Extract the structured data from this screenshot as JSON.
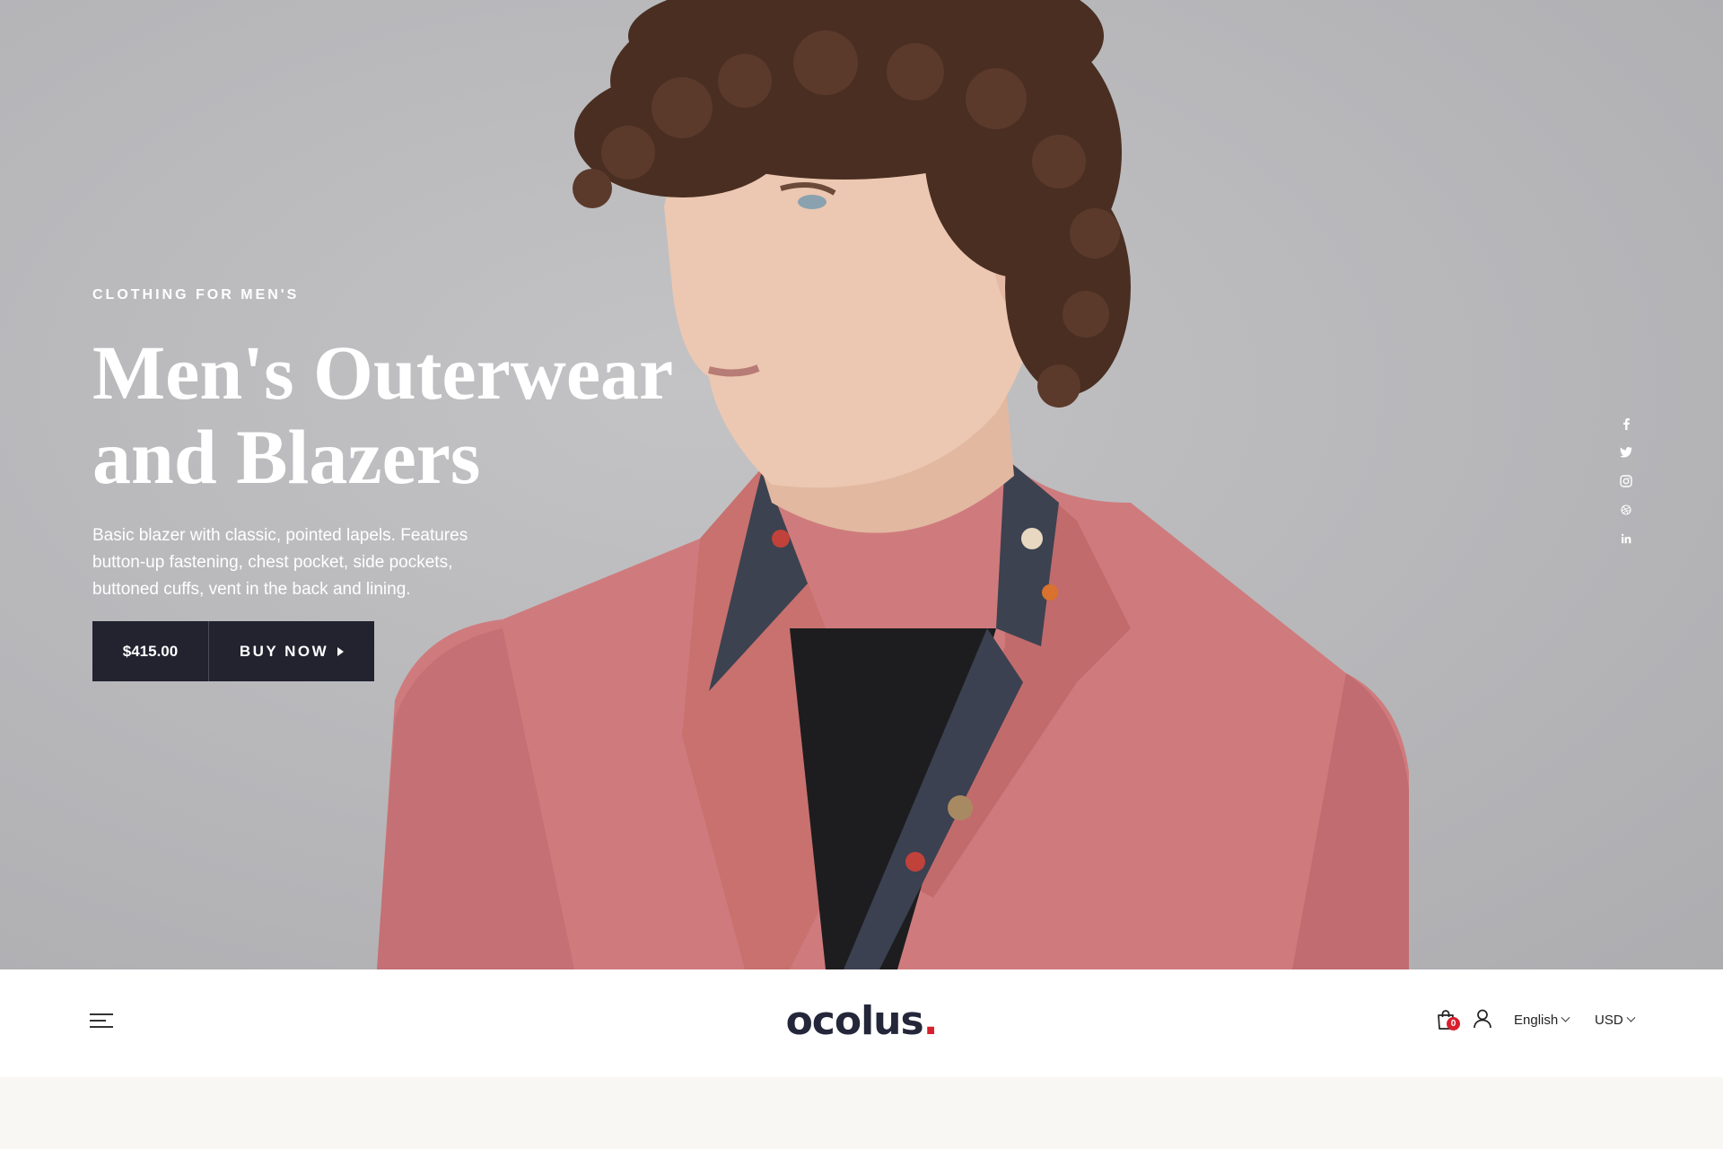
{
  "hero": {
    "eyebrow": "CLOTHING FOR MEN'S",
    "headline_line1": "Men's Outerwear",
    "headline_line2": "and Blazers",
    "description": "Basic blazer with classic, pointed lapels. Features button-up fastening, chest pocket, side pockets, buttoned cuffs, vent in the back and lining.",
    "price": "$415.00",
    "buy_label": "BUY NOW"
  },
  "social": [
    "facebook-icon",
    "twitter-icon",
    "instagram-icon",
    "dribbble-icon",
    "linkedin-icon"
  ],
  "header": {
    "logo_word": "ocolus",
    "logo_dot": ".",
    "cart_count": "0",
    "language": "English",
    "currency": "USD"
  },
  "colors": {
    "dark": "#22232f",
    "accent": "#d8202d",
    "blazer": "#cf7b7d",
    "background": "#b9b9bc"
  }
}
